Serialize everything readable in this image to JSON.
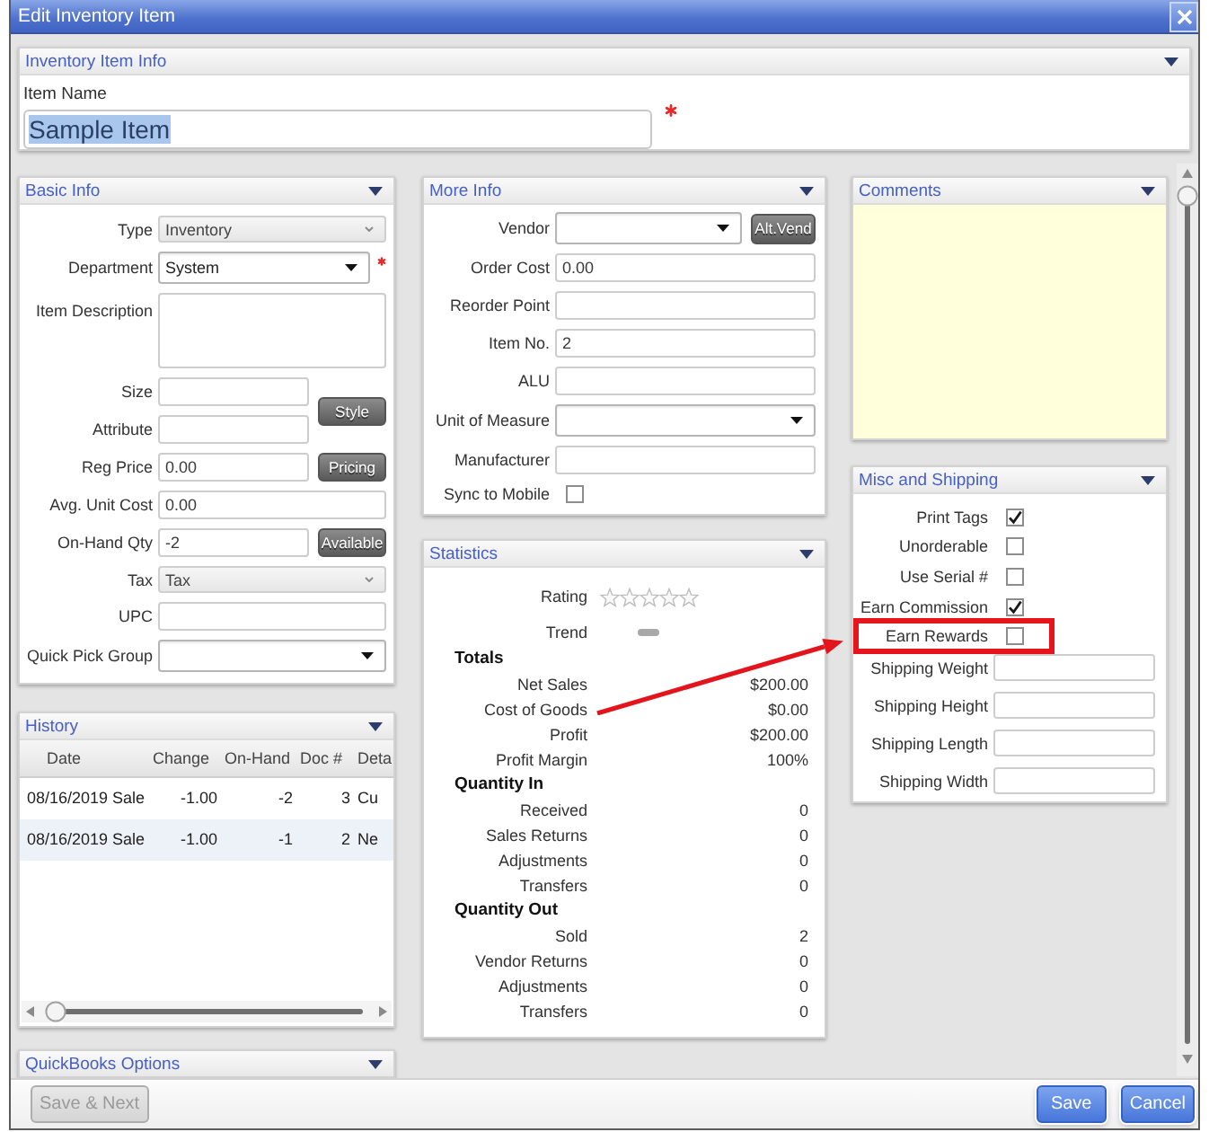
{
  "window": {
    "title": "Edit Inventory Item"
  },
  "item_info": {
    "title": "Inventory Item Info",
    "label": "Item Name",
    "value": "Sample Item",
    "text_selected": true,
    "required": true
  },
  "basic_info": {
    "title": "Basic Info",
    "fields": [
      {
        "kind": "select",
        "label": "Type",
        "value": "Inventory",
        "disabled": true,
        "required": false
      },
      {
        "kind": "select",
        "label": "Department",
        "value": "System",
        "disabled": false,
        "required": true
      },
      {
        "kind": "textarea",
        "label": "Item Description",
        "required": false
      },
      {
        "kind": "group",
        "button": "Style",
        "fields": [
          {
            "kind": "text",
            "label": "Size",
            "required": false
          },
          {
            "kind": "text",
            "label": "Attribute",
            "required": false
          }
        ]
      },
      {
        "kind": "text",
        "label": "Reg Price",
        "value": "0.00",
        "button": "Pricing",
        "required": false
      },
      {
        "kind": "text",
        "label": "Avg. Unit Cost",
        "value": "0.00",
        "required": false
      },
      {
        "kind": "text",
        "label": "On-Hand Qty",
        "value": "-2",
        "button": "Available",
        "required": false
      },
      {
        "kind": "select",
        "label": "Tax",
        "value": "Tax",
        "disabled": true,
        "required": false
      },
      {
        "kind": "text",
        "label": "UPC",
        "required": false
      },
      {
        "kind": "select",
        "label": "Quick Pick Group",
        "disabled": false,
        "required": false
      }
    ]
  },
  "history": {
    "title": "History",
    "columns": [
      "Date",
      "Change",
      "On-Hand",
      "Doc #",
      "Deta"
    ],
    "rows": [
      [
        "08/16/2019 Sale",
        "-1.00",
        "-2",
        "3",
        "Cu"
      ],
      [
        "08/16/2019 Sale",
        "-1.00",
        "-1",
        "2",
        "Ne"
      ]
    ]
  },
  "quickbooks_options": {
    "title": "QuickBooks Options"
  },
  "more_info": {
    "title": "More Info",
    "fields": [
      {
        "kind": "select",
        "label": "Vendor",
        "disabled": false,
        "button": "Alt.Vend"
      },
      {
        "kind": "text",
        "label": "Order Cost",
        "value": "0.00"
      },
      {
        "kind": "text",
        "label": "Reorder Point"
      },
      {
        "kind": "text",
        "label": "Item No.",
        "value": "2"
      },
      {
        "kind": "text",
        "label": "ALU"
      },
      {
        "kind": "select",
        "label": "Unit of Measure",
        "disabled": false
      },
      {
        "kind": "text",
        "label": "Manufacturer"
      },
      {
        "kind": "checkbox",
        "label": "Sync to Mobile",
        "checked": false
      }
    ]
  },
  "statistics": {
    "title": "Statistics",
    "rating": {
      "label": "Rating",
      "stars": 0
    },
    "trend": {
      "label": "Trend"
    },
    "sections": [
      {
        "title": "Totals",
        "rows": [
          {
            "label": "Net Sales",
            "value": "$200.00"
          },
          {
            "label": "Cost of Goods",
            "value": "$0.00"
          },
          {
            "label": "Profit",
            "value": "$200.00"
          },
          {
            "label": "Profit Margin",
            "value": "100%"
          }
        ]
      },
      {
        "title": "Quantity In",
        "rows": [
          {
            "label": "Received",
            "value": "0"
          },
          {
            "label": "Sales Returns",
            "value": "0"
          },
          {
            "label": "Adjustments",
            "value": "0"
          },
          {
            "label": "Transfers",
            "value": "0"
          }
        ]
      },
      {
        "title": "Quantity Out",
        "rows": [
          {
            "label": "Sold",
            "value": "2"
          },
          {
            "label": "Vendor Returns",
            "value": "0"
          },
          {
            "label": "Adjustments",
            "value": "0"
          },
          {
            "label": "Transfers",
            "value": "0"
          }
        ]
      }
    ]
  },
  "comments": {
    "title": "Comments"
  },
  "misc_shipping": {
    "title": "Misc and Shipping",
    "fields": [
      {
        "kind": "checkbox",
        "label": "Print Tags",
        "checked": true,
        "annotated": false
      },
      {
        "kind": "checkbox",
        "label": "Unorderable",
        "checked": false,
        "annotated": false
      },
      {
        "kind": "checkbox",
        "label": "Use Serial #",
        "checked": false,
        "annotated": false
      },
      {
        "kind": "checkbox",
        "label": "Earn Commission",
        "checked": true,
        "annotated": false
      },
      {
        "kind": "checkbox",
        "label": "Earn Rewards",
        "checked": false,
        "annotated": true
      },
      {
        "kind": "text",
        "label": "Shipping Weight",
        "annotated": false
      },
      {
        "kind": "text",
        "label": "Shipping Height",
        "annotated": false
      },
      {
        "kind": "text",
        "label": "Shipping Length",
        "annotated": false
      },
      {
        "kind": "text",
        "label": "Shipping Width",
        "annotated": false
      }
    ]
  },
  "footer": {
    "start_buttons": [
      {
        "label": "Save & Next",
        "disabled": true
      }
    ],
    "end_buttons": [
      {
        "label": "Save",
        "disabled": false
      },
      {
        "label": "Cancel",
        "disabled": false
      }
    ]
  }
}
